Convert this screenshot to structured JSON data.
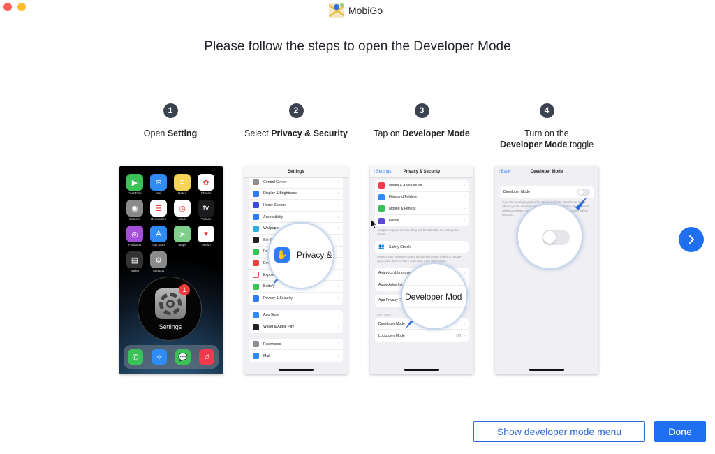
{
  "window": {
    "app_name": "MobiGo",
    "logo_icon": "map-pin-icon"
  },
  "heading": "Please follow the steps to open the Developer Mode",
  "steps": [
    {
      "number": "1",
      "prefix": "Open ",
      "bold": "Setting",
      "suffix": ""
    },
    {
      "number": "2",
      "prefix": "Select ",
      "bold": "Privacy & Security",
      "suffix": ""
    },
    {
      "number": "3",
      "prefix": "Tap on ",
      "bold": "Developer Mode",
      "suffix": ""
    },
    {
      "number": "4",
      "line1": "Turn on the",
      "bold": "Developer Mode",
      "suffix": " toggle"
    }
  ],
  "phone1": {
    "apps": [
      {
        "label": "FaceTime",
        "color": "#3ac259",
        "glyph": "▶"
      },
      {
        "label": "Mail",
        "color": "#2f8cf6",
        "glyph": "✉"
      },
      {
        "label": "Notes",
        "color": "#f6d45a",
        "glyph": "≡"
      },
      {
        "label": "Photos",
        "color": "#ffffff",
        "glyph": "✿"
      },
      {
        "label": "Camera",
        "color": "#8a8a8a",
        "glyph": "◉"
      },
      {
        "label": "Reminders",
        "color": "#ffffff",
        "glyph": "☰"
      },
      {
        "label": "Clock",
        "color": "#ffffff",
        "glyph": "◷"
      },
      {
        "label": "Videos",
        "color": "#1c1c1e",
        "glyph": "tv"
      },
      {
        "label": "Podcasts",
        "color": "#a34fd8",
        "glyph": "◎"
      },
      {
        "label": "App Store",
        "color": "#2f8cf6",
        "glyph": "A"
      },
      {
        "label": "Maps",
        "color": "#7fcf8a",
        "glyph": "➤"
      },
      {
        "label": "Health",
        "color": "#ffffff",
        "glyph": "♥"
      },
      {
        "label": "Wallet",
        "color": "#333333",
        "glyph": "▤"
      },
      {
        "label": "Settings",
        "color": "#8a8a8a",
        "glyph": "⚙"
      }
    ],
    "magnified_label": "Settings",
    "badge": "1",
    "dock": [
      {
        "name": "phone",
        "color": "#3ac259",
        "glyph": "✆"
      },
      {
        "name": "safari",
        "color": "#2f8cf6",
        "glyph": "✧"
      },
      {
        "name": "messages",
        "color": "#3ac259",
        "glyph": "💬"
      },
      {
        "name": "music",
        "color": "#f2394e",
        "glyph": "♫"
      }
    ]
  },
  "phone2": {
    "title": "Settings",
    "group1": [
      {
        "label": "Control Center",
        "color": "#8e8e93"
      },
      {
        "label": "Display & Brightness",
        "color": "#2f7cf6"
      },
      {
        "label": "Home Screen",
        "color": "#3b4bd8"
      },
      {
        "label": "Accessibility",
        "color": "#2f7cf6"
      },
      {
        "label": "Wallpaper",
        "color": "#35aadc"
      },
      {
        "label": "Siri & Search",
        "color": "#222222"
      },
      {
        "label": "Face ID & Passcode",
        "color": "#3ac259"
      },
      {
        "label": "Emergency SOS",
        "color": "#e8423a"
      },
      {
        "label": "Exposure Notifications",
        "color": "#ffffff"
      },
      {
        "label": "Battery",
        "color": "#3ac259"
      },
      {
        "label": "Privacy & Security",
        "color": "#2f7cf6"
      }
    ],
    "group2": [
      {
        "label": "App Store",
        "color": "#2f8cf6"
      },
      {
        "label": "Wallet & Apple Pay",
        "color": "#222222"
      }
    ],
    "group3": [
      {
        "label": "Passwords",
        "color": "#8e8e93"
      },
      {
        "label": "Mail",
        "color": "#2f8cf6"
      }
    ],
    "magnified_label": "Privacy &"
  },
  "phone3": {
    "back": "Settings",
    "title": "Privacy & Security",
    "group1": [
      {
        "label": "Media & Apple Music",
        "color": "#f2394e"
      },
      {
        "label": "Files and Folders",
        "color": "#2f8cf6"
      },
      {
        "label": "Motion & Fitness",
        "color": "#3ac259"
      },
      {
        "label": "Focus",
        "color": "#5a48d6"
      }
    ],
    "note1": "As apps request access, they will be added in the categories above.",
    "safety_check": "Safety Check",
    "note2": "Protect your personal safety by staying aware of which people, apps, and devices have access to your information.",
    "group3": [
      {
        "label": "Analytics & Improvements"
      },
      {
        "label": "Apple Advertising"
      }
    ],
    "app_privacy": "App Privacy Report",
    "section": "SECURITY",
    "security": [
      {
        "label": "Developer Mode",
        "value": ""
      },
      {
        "label": "Lockdown Mode",
        "value": "Off"
      }
    ],
    "magnified_label": "Developer Mod"
  },
  "phone4": {
    "back": "Back",
    "title": "Developer Mode",
    "toggle_label": "Developer Mode",
    "toggle_on": false,
    "note": "If you're developing apps for Apple products, Developer Mode allows you to use features that are required for app development. While Developer Mode is turned on, your device security will be reduced."
  },
  "buttons": {
    "next_icon": "chevron-right-icon",
    "show_menu": "Show developer mode menu",
    "done": "Done"
  },
  "colors": {
    "accent": "#1f6ff0",
    "step_badge": "#3b4350"
  }
}
